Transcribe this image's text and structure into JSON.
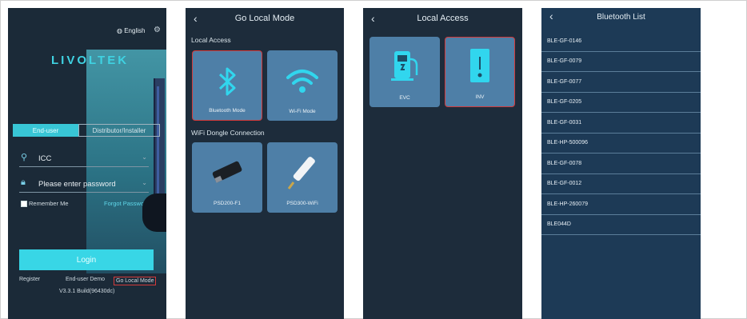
{
  "login": {
    "language": "English",
    "logo": "LIVOLTEK",
    "tab_enduser": "End-user",
    "tab_distributor": "Distributor/Installer",
    "username_value": "ICC",
    "password_placeholder": "Please enter password",
    "remember_label": "Remember Me",
    "forgot_label": "Forgot Password?",
    "login_label": "Login",
    "register_label": "Register",
    "demo_label": "End-user Demo",
    "local_mode_label": "Go Local Mode",
    "version": "V3.3.1 Build(96430dc)"
  },
  "local_mode": {
    "title": "Go Local Mode",
    "section_local": "Local Access",
    "bluetooth_label": "Bluetooth Mode",
    "wifi_label": "Wi-Fi Mode",
    "section_dongle": "WiFi Dongle Connection",
    "dongle1_label": "PSD200-F1",
    "dongle2_label": "PSD300-WiFi"
  },
  "local_access": {
    "title": "Local Access",
    "evc_label": "EVC",
    "inv_label": "INV"
  },
  "bluetooth_list": {
    "title": "Bluetooth List",
    "devices": [
      "BLE-GF-0146",
      "BLE-GF-0079",
      "BLE-GF-0077",
      "BLE-GF-0205",
      "BLE-GF-0031",
      "BLE-HP-500096",
      "BLE-GF-0078",
      "BLE-GF-0012",
      "BLE-HP-260079",
      "BLE044D"
    ]
  },
  "colors": {
    "accent": "#38d6e6",
    "tile": "#4e7fa7",
    "selection": "#d33a3a"
  }
}
